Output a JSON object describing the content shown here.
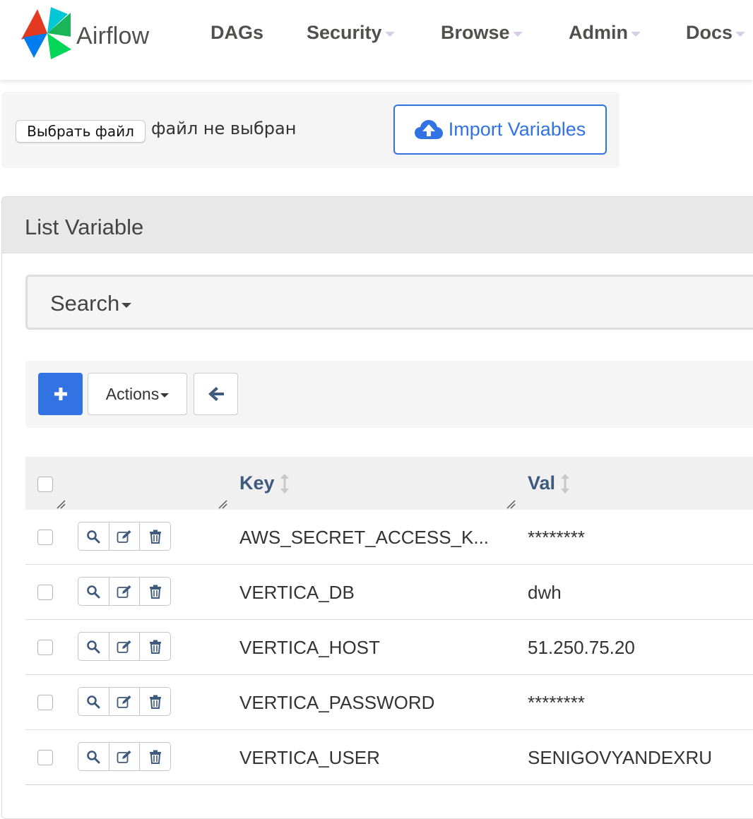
{
  "navbar": {
    "brand": "Airflow",
    "items": [
      {
        "label": "DAGs",
        "dropdown": false
      },
      {
        "label": "Security",
        "dropdown": true
      },
      {
        "label": "Browse",
        "dropdown": true
      },
      {
        "label": "Admin",
        "dropdown": true
      },
      {
        "label": "Docs",
        "dropdown": true
      }
    ]
  },
  "import": {
    "file_button_label": "Выбрать файл",
    "file_status": "файл не выбран",
    "import_button_label": "Import Variables",
    "import_icon": "cloud-upload-icon"
  },
  "list": {
    "title": "List Variable",
    "search_label": "Search",
    "toolbar": {
      "add_label": "+",
      "actions_label": "Actions",
      "back_icon": "arrow-left-icon"
    },
    "columns": {
      "key": "Key",
      "val": "Val"
    },
    "rows": [
      {
        "key": "AWS_SECRET_ACCESS_K...",
        "val": "********"
      },
      {
        "key": "VERTICA_DB",
        "val": "dwh"
      },
      {
        "key": "VERTICA_HOST",
        "val": "51.250.75.20"
      },
      {
        "key": "VERTICA_PASSWORD",
        "val": "********"
      },
      {
        "key": "VERTICA_USER",
        "val": "SENIGOVYANDEXRU"
      }
    ],
    "row_action_icons": [
      "search-icon",
      "edit-icon",
      "trash-icon"
    ]
  },
  "colors": {
    "primary": "#3173e3",
    "header_link": "#3e5a7e",
    "nav_text": "#51504f",
    "panel_bg": "#f5f5f5"
  }
}
